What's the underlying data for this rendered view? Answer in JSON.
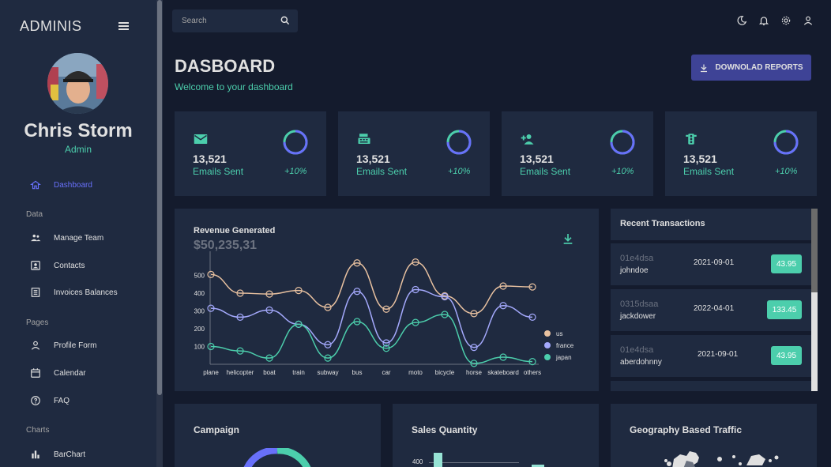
{
  "sidebar": {
    "brand": "ADMINIS",
    "profile": {
      "name": "Chris Storm",
      "role": "Admin"
    },
    "items": [
      {
        "label": "Dashboard",
        "icon": "home-icon",
        "active": true
      },
      {
        "label": "Manage Team",
        "icon": "people-icon"
      },
      {
        "label": "Contacts",
        "icon": "contacts-icon"
      },
      {
        "label": "Invoices Balances",
        "icon": "receipt-icon"
      },
      {
        "label": "Profile Form",
        "icon": "person-icon"
      },
      {
        "label": "Calendar",
        "icon": "calendar-icon"
      },
      {
        "label": "FAQ",
        "icon": "help-icon"
      },
      {
        "label": "BarChart",
        "icon": "bar-chart-icon"
      }
    ],
    "sections": [
      "Data",
      "Pages",
      "Charts"
    ]
  },
  "topbar": {
    "search_placeholder": "Search",
    "icons": [
      "dark-mode-icon",
      "notifications-icon",
      "settings-icon",
      "account-icon"
    ]
  },
  "header": {
    "title": "DASBOARD",
    "subtitle": "Welcome to your dashboard",
    "download_label": "DOWNOLAD REPORTS"
  },
  "stats": [
    {
      "value": "13,521",
      "label": "Emails Sent",
      "increase": "+10%",
      "icon": "email-icon",
      "progress": 0.75
    },
    {
      "value": "13,521",
      "label": "Emails Sent",
      "increase": "+10%",
      "icon": "point-of-sale-icon",
      "progress": 0.75
    },
    {
      "value": "13,521",
      "label": "Emails Sent",
      "increase": "+10%",
      "icon": "person-add-icon",
      "progress": 0.75
    },
    {
      "value": "13,521",
      "label": "Emails Sent",
      "increase": "+10%",
      "icon": "traffic-icon",
      "progress": 0.75
    }
  ],
  "revenue": {
    "title": "Revenue Generated",
    "amount": "$50,235,31"
  },
  "chart_data": {
    "type": "line",
    "categories": [
      "plane",
      "helicopter",
      "boat",
      "train",
      "subway",
      "bus",
      "car",
      "moto",
      "bicycle",
      "horse",
      "skateboard",
      "others"
    ],
    "yticks": [
      100,
      200,
      300,
      400,
      500
    ],
    "ylim": [
      0,
      600
    ],
    "series": [
      {
        "name": "us",
        "color": "#e8c1a0",
        "values": [
          505,
          400,
          395,
          415,
          320,
          570,
          310,
          575,
          385,
          285,
          440,
          435
        ]
      },
      {
        "name": "france",
        "color": "#a4a9fc",
        "values": [
          315,
          265,
          305,
          225,
          110,
          410,
          120,
          420,
          380,
          95,
          330,
          265
        ]
      },
      {
        "name": "japan",
        "color": "#4cceac",
        "values": [
          100,
          75,
          35,
          225,
          35,
          240,
          90,
          235,
          280,
          5,
          40,
          15
        ]
      }
    ],
    "legend_position": "right"
  },
  "transactions": {
    "title": "Recent Transactions",
    "rows": [
      {
        "txId": "01e4dsa",
        "user": "johndoe",
        "date": "2021-09-01",
        "cost": "43.95"
      },
      {
        "txId": "0315dsaa",
        "user": "jackdower",
        "date": "2022-04-01",
        "cost": "133.45"
      },
      {
        "txId": "01e4dsa",
        "user": "aberdohnny",
        "date": "2021-09-01",
        "cost": "43.95"
      }
    ]
  },
  "bottom": {
    "campaign_title": "Campaign",
    "sales_title": "Sales Quantity",
    "sales_ytick": "400",
    "geo_title": "Geography Based Traffic"
  },
  "colors": {
    "accent": "#4cceac",
    "primary_button": "#3e4396",
    "active_nav": "#6870fa",
    "panel": "#1f2a40",
    "background": "#141b2d"
  }
}
